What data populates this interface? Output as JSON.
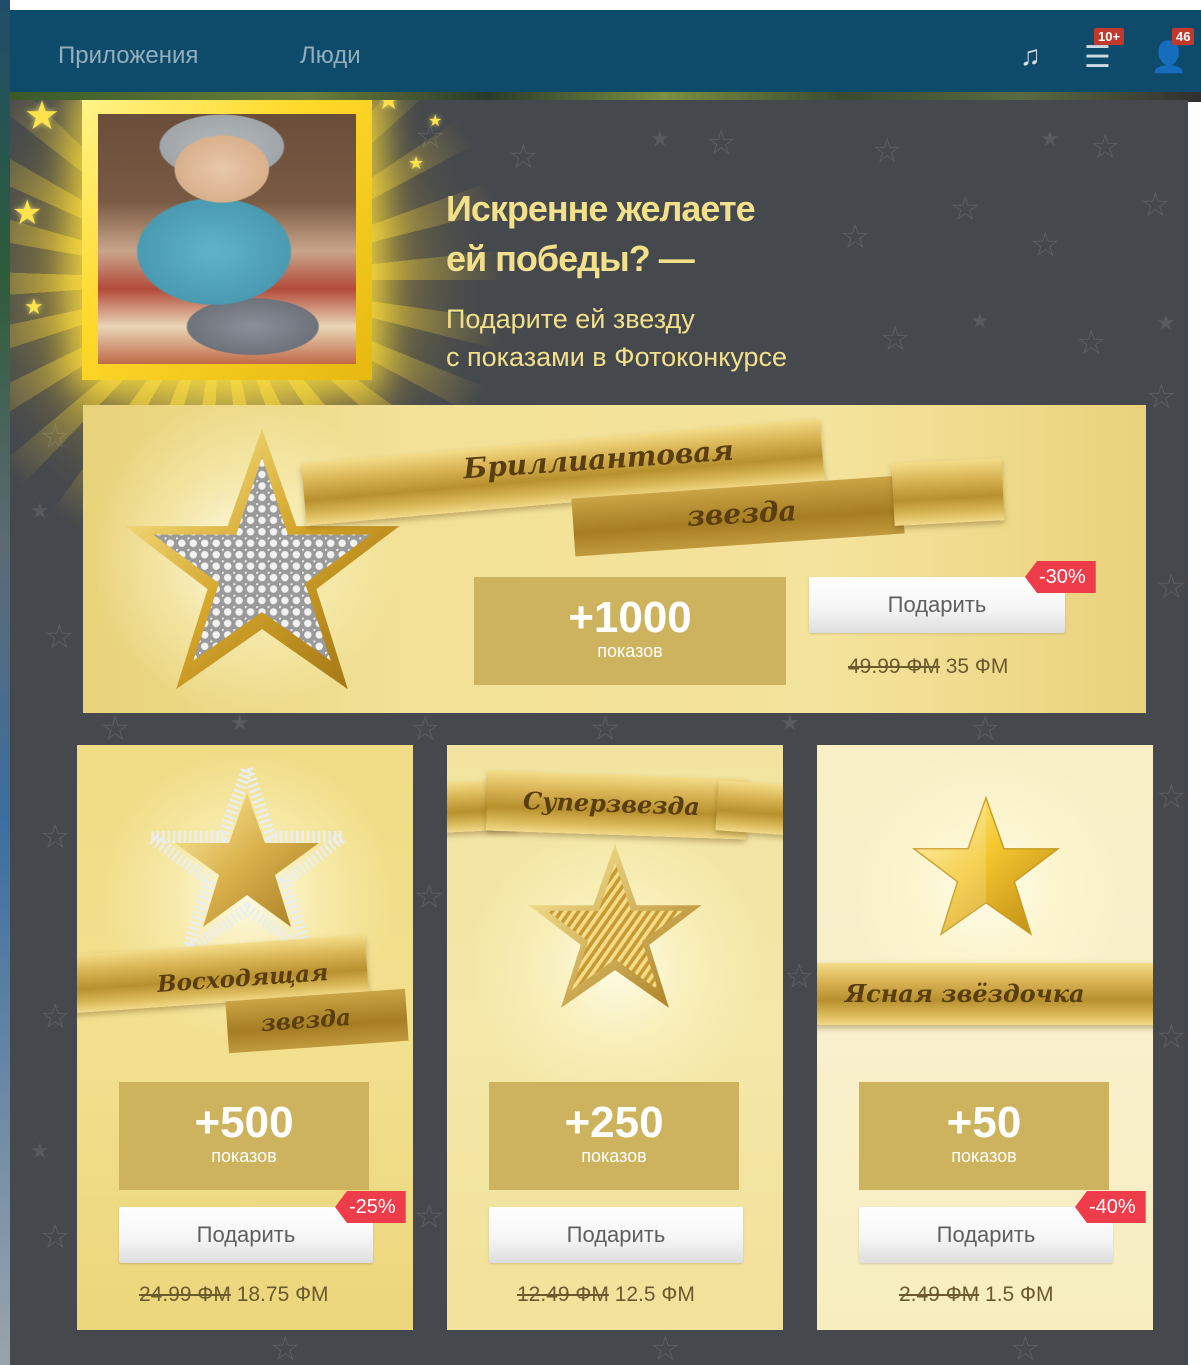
{
  "topbar": {
    "nav_apps": "Приложения",
    "nav_people": "Люди",
    "music_icon": "music-note-icon",
    "notifications_badge": "10+",
    "friends_badge": "46"
  },
  "promo": {
    "headline_line1": "Искренне желаете",
    "headline_line2": "ей победы? —",
    "sub_line1": "Подарите ей звезду",
    "sub_line2": "с показами в Фотоконкурсе"
  },
  "offers": [
    {
      "title_line1": "Бриллиантовая",
      "title_line2": "звезда",
      "count": "+1000",
      "count_label": "показов",
      "button": "Подарить",
      "discount": "-30%",
      "old_price": "49.99 ФМ",
      "new_price": "35 ФМ"
    },
    {
      "title_line1": "Восходящая",
      "title_line2": "звезда",
      "count": "+500",
      "count_label": "показов",
      "button": "Подарить",
      "discount": "-25%",
      "old_price": "24.99 ФМ",
      "new_price": "18.75 ФМ"
    },
    {
      "title_line1": "Суперзвезда",
      "count": "+250",
      "count_label": "показов",
      "button": "Подарить",
      "old_price": "12.49 ФМ",
      "new_price": "12.5 ФМ"
    },
    {
      "title_line1": "Ясная звёздочка",
      "count": "+50",
      "count_label": "показов",
      "button": "Подарить",
      "discount": "-40%",
      "old_price": "2.49 ФМ",
      "new_price": "1.5 ФМ"
    }
  ],
  "colors": {
    "modal_bg": "#45484d",
    "headline": "#f2e08a",
    "count_box": "#cdb35e",
    "discount": "#ef3c4b",
    "topbar": "#0e4a69"
  }
}
